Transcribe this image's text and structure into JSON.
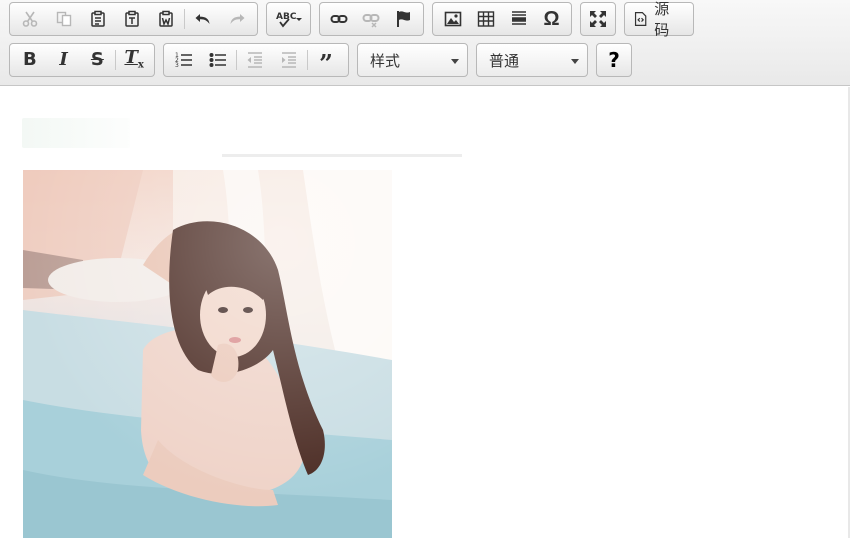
{
  "toolbar": {
    "row1": [
      {
        "name": "cut",
        "icon": "scissors-icon",
        "enabled": false
      },
      {
        "name": "copy",
        "icon": "copy-icon",
        "enabled": false
      },
      {
        "name": "paste",
        "icon": "paste-icon",
        "enabled": true
      },
      {
        "name": "paste-text",
        "icon": "paste-text-icon",
        "enabled": true
      },
      {
        "name": "paste-word",
        "icon": "paste-word-icon",
        "enabled": true
      },
      {
        "name": "undo",
        "icon": "undo-icon",
        "enabled": true
      },
      {
        "name": "redo",
        "icon": "redo-icon",
        "enabled": false
      },
      {
        "name": "spellcheck",
        "icon": "spellcheck-icon",
        "enabled": true
      },
      {
        "name": "link",
        "icon": "link-icon",
        "enabled": true
      },
      {
        "name": "unlink",
        "icon": "unlink-icon",
        "enabled": false
      },
      {
        "name": "anchor",
        "icon": "flag-icon",
        "enabled": true
      },
      {
        "name": "image",
        "icon": "image-icon",
        "enabled": true
      },
      {
        "name": "table",
        "icon": "table-icon",
        "enabled": true
      },
      {
        "name": "horizontal-rule",
        "icon": "horizontal-rule-icon",
        "enabled": true
      },
      {
        "name": "special-char",
        "icon": "omega-icon",
        "enabled": true
      },
      {
        "name": "maximize",
        "icon": "maximize-icon",
        "enabled": true
      }
    ],
    "source": {
      "label": "源码",
      "icon": "source-icon"
    },
    "row2": [
      {
        "name": "bold",
        "icon": "bold-icon",
        "enabled": true
      },
      {
        "name": "italic",
        "icon": "italic-icon",
        "enabled": true
      },
      {
        "name": "strike",
        "icon": "strike-icon",
        "enabled": true
      },
      {
        "name": "remove-format",
        "icon": "remove-format-icon",
        "enabled": true
      },
      {
        "name": "numbered-list",
        "icon": "numbered-list-icon",
        "enabled": true
      },
      {
        "name": "bulleted-list",
        "icon": "bulleted-list-icon",
        "enabled": true
      },
      {
        "name": "outdent",
        "icon": "outdent-icon",
        "enabled": false
      },
      {
        "name": "indent",
        "icon": "indent-icon",
        "enabled": false
      },
      {
        "name": "blockquote",
        "icon": "blockquote-icon",
        "enabled": true
      }
    ],
    "styles_combo": {
      "value": "样式"
    },
    "format_combo": {
      "value": "普通"
    },
    "help": {
      "label": "?",
      "icon": "help-icon"
    }
  },
  "content": {
    "image": {
      "description_icon": "photo-image"
    }
  },
  "colors": {
    "icon": "#333333",
    "icon_disabled": "#b7b7b7",
    "border": "#b8b8b8"
  }
}
